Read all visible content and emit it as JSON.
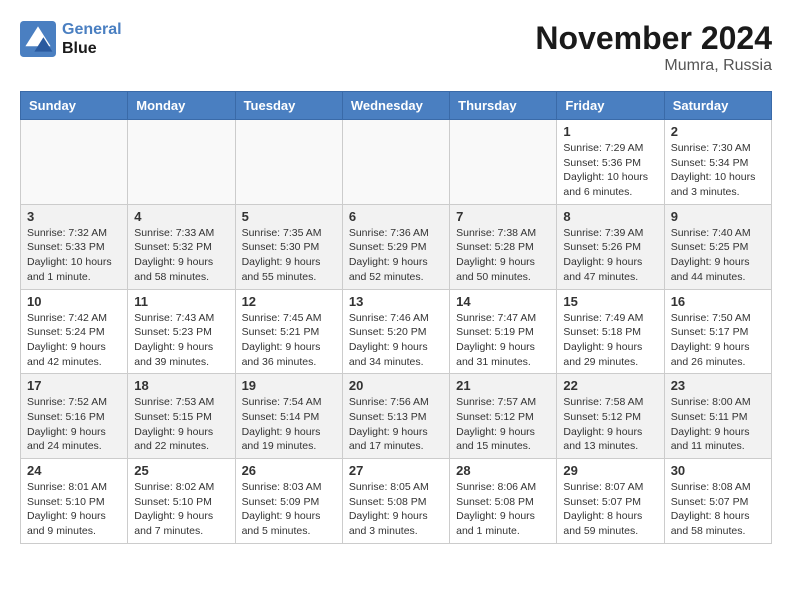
{
  "logo": {
    "line1": "General",
    "line2": "Blue"
  },
  "title": "November 2024",
  "location": "Mumra, Russia",
  "headers": [
    "Sunday",
    "Monday",
    "Tuesday",
    "Wednesday",
    "Thursday",
    "Friday",
    "Saturday"
  ],
  "weeks": [
    [
      {
        "day": "",
        "info": ""
      },
      {
        "day": "",
        "info": ""
      },
      {
        "day": "",
        "info": ""
      },
      {
        "day": "",
        "info": ""
      },
      {
        "day": "",
        "info": ""
      },
      {
        "day": "1",
        "info": "Sunrise: 7:29 AM\nSunset: 5:36 PM\nDaylight: 10 hours\nand 6 minutes."
      },
      {
        "day": "2",
        "info": "Sunrise: 7:30 AM\nSunset: 5:34 PM\nDaylight: 10 hours\nand 3 minutes."
      }
    ],
    [
      {
        "day": "3",
        "info": "Sunrise: 7:32 AM\nSunset: 5:33 PM\nDaylight: 10 hours\nand 1 minute."
      },
      {
        "day": "4",
        "info": "Sunrise: 7:33 AM\nSunset: 5:32 PM\nDaylight: 9 hours\nand 58 minutes."
      },
      {
        "day": "5",
        "info": "Sunrise: 7:35 AM\nSunset: 5:30 PM\nDaylight: 9 hours\nand 55 minutes."
      },
      {
        "day": "6",
        "info": "Sunrise: 7:36 AM\nSunset: 5:29 PM\nDaylight: 9 hours\nand 52 minutes."
      },
      {
        "day": "7",
        "info": "Sunrise: 7:38 AM\nSunset: 5:28 PM\nDaylight: 9 hours\nand 50 minutes."
      },
      {
        "day": "8",
        "info": "Sunrise: 7:39 AM\nSunset: 5:26 PM\nDaylight: 9 hours\nand 47 minutes."
      },
      {
        "day": "9",
        "info": "Sunrise: 7:40 AM\nSunset: 5:25 PM\nDaylight: 9 hours\nand 44 minutes."
      }
    ],
    [
      {
        "day": "10",
        "info": "Sunrise: 7:42 AM\nSunset: 5:24 PM\nDaylight: 9 hours\nand 42 minutes."
      },
      {
        "day": "11",
        "info": "Sunrise: 7:43 AM\nSunset: 5:23 PM\nDaylight: 9 hours\nand 39 minutes."
      },
      {
        "day": "12",
        "info": "Sunrise: 7:45 AM\nSunset: 5:21 PM\nDaylight: 9 hours\nand 36 minutes."
      },
      {
        "day": "13",
        "info": "Sunrise: 7:46 AM\nSunset: 5:20 PM\nDaylight: 9 hours\nand 34 minutes."
      },
      {
        "day": "14",
        "info": "Sunrise: 7:47 AM\nSunset: 5:19 PM\nDaylight: 9 hours\nand 31 minutes."
      },
      {
        "day": "15",
        "info": "Sunrise: 7:49 AM\nSunset: 5:18 PM\nDaylight: 9 hours\nand 29 minutes."
      },
      {
        "day": "16",
        "info": "Sunrise: 7:50 AM\nSunset: 5:17 PM\nDaylight: 9 hours\nand 26 minutes."
      }
    ],
    [
      {
        "day": "17",
        "info": "Sunrise: 7:52 AM\nSunset: 5:16 PM\nDaylight: 9 hours\nand 24 minutes."
      },
      {
        "day": "18",
        "info": "Sunrise: 7:53 AM\nSunset: 5:15 PM\nDaylight: 9 hours\nand 22 minutes."
      },
      {
        "day": "19",
        "info": "Sunrise: 7:54 AM\nSunset: 5:14 PM\nDaylight: 9 hours\nand 19 minutes."
      },
      {
        "day": "20",
        "info": "Sunrise: 7:56 AM\nSunset: 5:13 PM\nDaylight: 9 hours\nand 17 minutes."
      },
      {
        "day": "21",
        "info": "Sunrise: 7:57 AM\nSunset: 5:12 PM\nDaylight: 9 hours\nand 15 minutes."
      },
      {
        "day": "22",
        "info": "Sunrise: 7:58 AM\nSunset: 5:12 PM\nDaylight: 9 hours\nand 13 minutes."
      },
      {
        "day": "23",
        "info": "Sunrise: 8:00 AM\nSunset: 5:11 PM\nDaylight: 9 hours\nand 11 minutes."
      }
    ],
    [
      {
        "day": "24",
        "info": "Sunrise: 8:01 AM\nSunset: 5:10 PM\nDaylight: 9 hours\nand 9 minutes."
      },
      {
        "day": "25",
        "info": "Sunrise: 8:02 AM\nSunset: 5:10 PM\nDaylight: 9 hours\nand 7 minutes."
      },
      {
        "day": "26",
        "info": "Sunrise: 8:03 AM\nSunset: 5:09 PM\nDaylight: 9 hours\nand 5 minutes."
      },
      {
        "day": "27",
        "info": "Sunrise: 8:05 AM\nSunset: 5:08 PM\nDaylight: 9 hours\nand 3 minutes."
      },
      {
        "day": "28",
        "info": "Sunrise: 8:06 AM\nSunset: 5:08 PM\nDaylight: 9 hours\nand 1 minute."
      },
      {
        "day": "29",
        "info": "Sunrise: 8:07 AM\nSunset: 5:07 PM\nDaylight: 8 hours\nand 59 minutes."
      },
      {
        "day": "30",
        "info": "Sunrise: 8:08 AM\nSunset: 5:07 PM\nDaylight: 8 hours\nand 58 minutes."
      }
    ]
  ]
}
